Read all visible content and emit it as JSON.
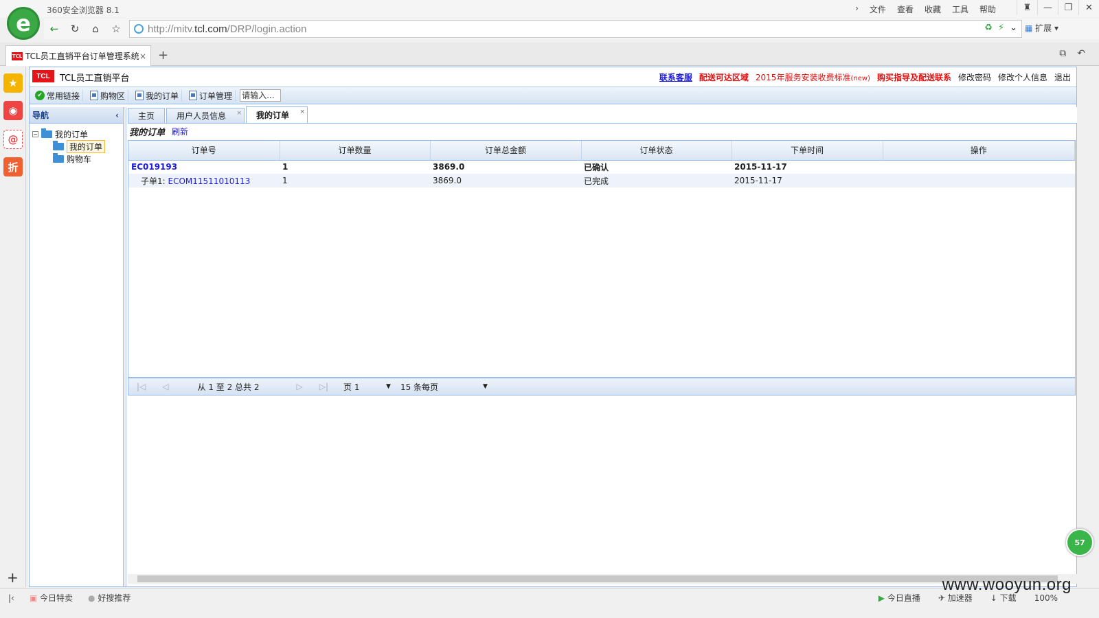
{
  "browser": {
    "app_title": "360安全浏览器 8.1",
    "menu": [
      "文件",
      "查看",
      "收藏",
      "工具",
      "帮助"
    ],
    "url_prefix": "http://mitv.",
    "url_domain": "tcl.com",
    "url_path": "/DRP/login.action",
    "ext_label": "扩展",
    "tab_title": "TCL员工直销平台订单管理系统",
    "tab_close": "×",
    "tcl_mini": "TCL",
    "status_left": [
      "今日特卖",
      "好搜推荐"
    ],
    "status_right": [
      "今日直播",
      "加速器",
      "下载",
      "100%"
    ],
    "zoom_badge": "57"
  },
  "app": {
    "logo": "TCL",
    "title": "TCL员工直销平台",
    "header_links": {
      "contact": "联系客服",
      "delivery": "配送可达区域",
      "install": "2015年服务安装收费标准",
      "install_new": "(new)",
      "buy_guide": "购买指导及配送联系",
      "change_pwd": "修改密码",
      "change_info": "修改个人信息",
      "logout": "退出"
    },
    "toolbar": {
      "common_links": "常用链接",
      "cart": "购物区",
      "my_orders": "我的订单",
      "order_mgmt": "订单管理",
      "search_placeholder": "请输入..."
    },
    "nav": {
      "title": "导航",
      "tree_root": "我的订单",
      "tree_children": [
        "我的订单",
        "购物车"
      ]
    },
    "tabs": [
      "主页",
      "用户人员信息",
      "我的订单"
    ],
    "panel": {
      "title": "我的订单",
      "refresh": "刷新"
    },
    "grid": {
      "columns": [
        "订单号",
        "订单数量",
        "订单总金额",
        "订单状态",
        "下单时间",
        "操作"
      ],
      "main_row": {
        "order_id": "EC019193",
        "qty": "1",
        "amount": "3869.0",
        "status": "已确认",
        "date": "2015-11-17"
      },
      "sub_row": {
        "prefix": "子单1:",
        "order_id": "ECOM11511010113",
        "qty": "1",
        "amount": "3869.0",
        "status": "已完成",
        "date": "2015-11-17"
      }
    },
    "pager": {
      "summary": "从 1 至 2 总共 2",
      "page": "页 1",
      "per_page": "15 条每页"
    }
  },
  "watermark": "www.wooyun.org"
}
